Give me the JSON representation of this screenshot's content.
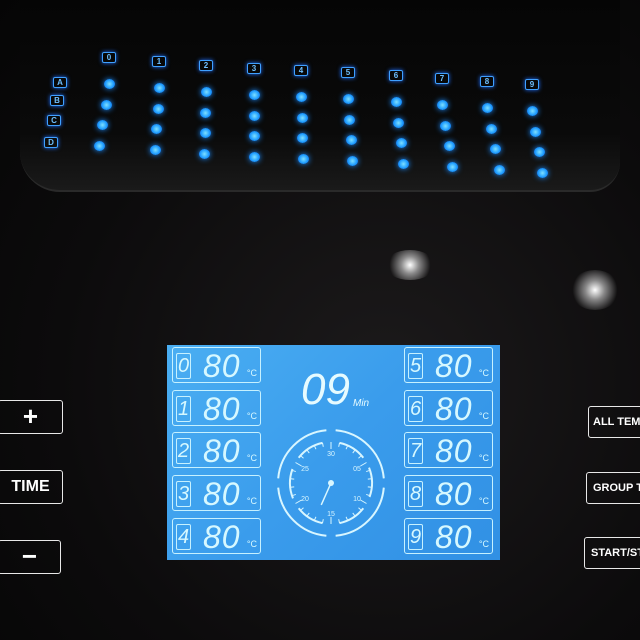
{
  "led_panel": {
    "row_labels": [
      "A",
      "B",
      "C",
      "D"
    ],
    "column_labels": [
      "0",
      "1",
      "2",
      "3",
      "4",
      "5",
      "6",
      "7",
      "8",
      "9"
    ],
    "led_color": "#1f9dff"
  },
  "lcd": {
    "background_color": "#3a9cec",
    "timer": {
      "value": "09",
      "unit": "Min"
    },
    "dial": {
      "labels": [
        "30",
        "05",
        "10",
        "15",
        "20",
        "25"
      ],
      "needle_minutes": 17
    },
    "channels": [
      {
        "index": "0",
        "temp": "80",
        "unit": "°C"
      },
      {
        "index": "1",
        "temp": "80",
        "unit": "°C"
      },
      {
        "index": "2",
        "temp": "80",
        "unit": "°C"
      },
      {
        "index": "3",
        "temp": "80",
        "unit": "°C"
      },
      {
        "index": "4",
        "temp": "80",
        "unit": "°C"
      },
      {
        "index": "5",
        "temp": "80",
        "unit": "°C"
      },
      {
        "index": "6",
        "temp": "80",
        "unit": "°C"
      },
      {
        "index": "7",
        "temp": "80",
        "unit": "°C"
      },
      {
        "index": "8",
        "temp": "80",
        "unit": "°C"
      },
      {
        "index": "9",
        "temp": "80",
        "unit": "°C"
      }
    ]
  },
  "buttons": {
    "plus": "+",
    "time": "TIME",
    "minus": "−",
    "all_temp": "ALL TEMP",
    "group_temp": "GROUP TEM",
    "start_stop": "START/STO"
  }
}
